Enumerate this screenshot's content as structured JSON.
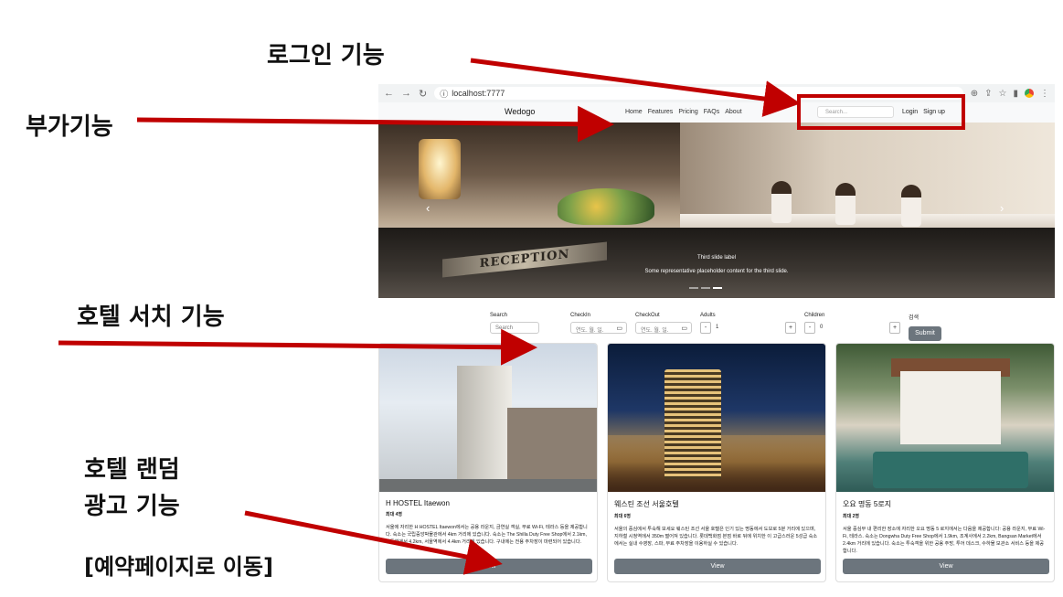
{
  "annotations": {
    "login": "로그인 기능",
    "extra": "부가기능",
    "search": "호텔 서치 기능",
    "random_line1": "호텔 랜덤",
    "random_line2": "광고 기능",
    "move": "[예약페이지로 이동]"
  },
  "browser": {
    "url": "localhost:7777"
  },
  "navbar": {
    "brand": "Wedogo",
    "menu": [
      "Home",
      "Features",
      "Pricing",
      "FAQs",
      "About"
    ],
    "search_placeholder": "Search...",
    "login": "Login",
    "signup": "Sign up"
  },
  "hero": {
    "sign_text": "RECEPTION",
    "caption_title": "Third slide label",
    "caption_text": "Some representative placeholder content for the third slide.",
    "prev_icon": "‹",
    "next_icon": "›"
  },
  "search_form": {
    "search_label": "Search",
    "search_placeholder": "Search",
    "checkin_label": "CheckIn",
    "checkin_value": "연도. 월. 일.",
    "checkout_label": "CheckOut",
    "checkout_value": "연도. 월. 일.",
    "adults_label": "Adults",
    "adults_value": "1",
    "children_label": "Children",
    "children_value": "0",
    "minus": "-",
    "plus": "+",
    "submit_caption": "검색",
    "submit_label": "Submit"
  },
  "cards": [
    {
      "title": "H HOSTEL Itaewon",
      "capacity": "최대 4명",
      "description": "서울에 자리한 H HOSTEL Itaewon에서는 공용 라운지, 금연실 객실, 무료 Wi-Fi, 테라스 등을 제공합니다. 숙소는 국립중앙박물관에서 4km 거리에 있습니다. 숙소는 The Shilla Duty Free Shop에서 2.1km, 명동역에서 4.2km, 서울역에서 4.4km 거리에 있습니다. 구내에는 전용 주차장이 마련되어 있습니다.",
      "button": "View"
    },
    {
      "title": "웨스틴 조선 서울호텔",
      "capacity": "최대 6명",
      "description": "서울의 중심에서 투숙해 보세요 웨스틴 조선 서울 호텔은 인기 있는 명동에서 도보로 5분 거리에 있으며, 지하철 시청역에서 350m 떨어져 있습니다. 롯데백화점 본점 바로 뒤에 위치한 이 고급스러운 5성급 숙소에서는 실내 수영장, 스파, 무료 주차장을 이용하실 수 있습니다.",
      "button": "View"
    },
    {
      "title": "오요 명동 5로지",
      "capacity": "최대 2명",
      "description": "서울 중심부 내 편리한 장소에 자리한 오요 명동 5 로지에서는 다음을 제공합니다: 공용 라운지, 무료 Wi-Fi, 테라스. 숙소는 Dongwha Duty Free Shop에서 1.9km, 조계사에서 2.2km, Bangsan Market에서 2.4km 거리에 있습니다. 숙소는 투숙객을 위한 공용 주방, 투어 데스크, 수하물 보관소 서비스 등을 제공합니다.",
      "button": "View"
    }
  ],
  "colors": {
    "annotation_red": "#c00000",
    "button_gray": "#6c757d"
  },
  "icons": [
    "back-icon",
    "forward-icon",
    "reload-icon",
    "info-icon",
    "zoom-icon",
    "share-icon",
    "star-icon",
    "sidebar-icon",
    "chrome-icon",
    "kebab-icon",
    "calendar-icon",
    "chevron-left-icon",
    "chevron-right-icon"
  ]
}
